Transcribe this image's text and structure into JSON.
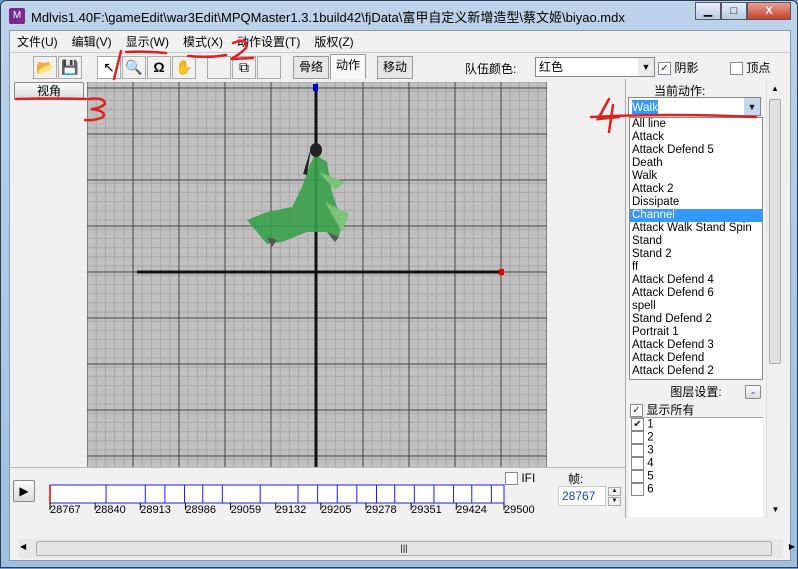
{
  "window": {
    "title": "Mdlvis1.40F:\\gameEdit\\war3Edit\\MPQMaster1.3.1build42\\fjData\\富甲自定义新增造型\\蔡文姬\\biyao.mdx",
    "minimize": "▁",
    "maximize": "□",
    "close": "X"
  },
  "menu": [
    "文件(U)",
    "编辑(V)",
    "显示(W)",
    "模式(X)",
    "动作设置(T)",
    "版权(Z)"
  ],
  "toolbar": {
    "tabs": [
      "骨络",
      "动作",
      "移动"
    ],
    "active_tab": "动作",
    "team_color_label": "队伍颜色:",
    "team_color_value": "红色",
    "shadow_label": "阴影",
    "shadow_checked": true,
    "vertex_label": "顶点",
    "vertex_checked": false
  },
  "view_button": "视角",
  "timeline": {
    "ticks": [
      "28767",
      "28840",
      "28913",
      "28986",
      "29059",
      "29132",
      "29205",
      "29278",
      "29351",
      "29424",
      "29500"
    ],
    "ifi_label": "IFI",
    "frame_label": "帧:",
    "frame_value": "28767"
  },
  "right_panel": {
    "current_action_label": "当前动作:",
    "current_action": "Walk",
    "actions": [
      "All line",
      "Attack",
      "Attack Defend 5",
      "Death",
      "Walk",
      "Attack 2",
      "Dissipate",
      "Channel",
      "Attack Walk Stand Spin",
      "Stand",
      "Stand 2",
      "ff",
      "Attack Defend 4",
      "Attack Defend 6",
      "spell",
      "Stand Defend 2",
      "Portrait 1",
      "Attack Defend 3",
      "Attack Defend",
      "Attack Defend 2"
    ],
    "highlighted": "Channel",
    "layer_label": "图层设置:",
    "layer_collapse": "-",
    "show_all_label": "显示所有",
    "layers": [
      {
        "name": "1",
        "checked": true
      },
      {
        "name": "2",
        "checked": false
      },
      {
        "name": "3",
        "checked": false
      },
      {
        "name": "4",
        "checked": false
      },
      {
        "name": "5",
        "checked": false
      },
      {
        "name": "6",
        "checked": false
      }
    ]
  },
  "annotations": [
    "1",
    "2",
    "3",
    "4"
  ],
  "colors": {
    "grid_bg": "#c0c0c0",
    "selection": "#3399ff",
    "figure": "#3aa04a",
    "annotation": "#e02020"
  }
}
